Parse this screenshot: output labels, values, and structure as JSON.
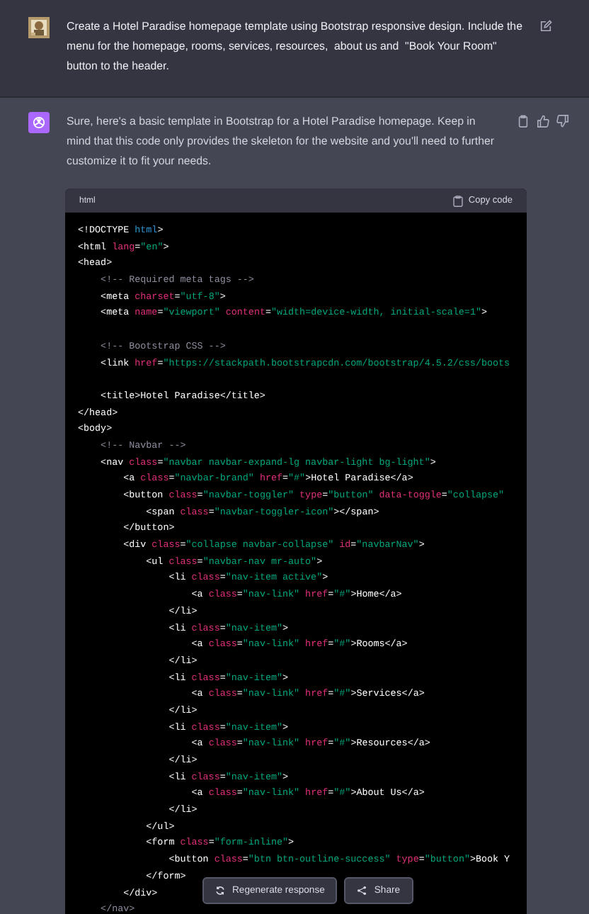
{
  "user_message": {
    "text": "Create a Hotel Paradise homepage template using Bootstrap responsive design. Include the menu for the homepage, rooms, services, resources,  about us and  \"Book Your Room\" button to the header."
  },
  "assistant_message": {
    "text": "Sure, here's a basic template in Bootstrap for a Hotel Paradise homepage. Keep in mind that this code only provides the skeleton for the website and you'll need to further customize it to fit your needs."
  },
  "code_block": {
    "language": "html",
    "copy_label": "Copy code",
    "lines": [
      {
        "tokens": [
          {
            "kind": "tag",
            "text": "<!DOCTYPE "
          },
          {
            "kind": "keyword",
            "text": "html"
          },
          {
            "kind": "tag",
            "text": ">"
          }
        ]
      },
      {
        "tokens": [
          {
            "kind": "tag",
            "text": "<html "
          },
          {
            "kind": "attr",
            "text": "lang"
          },
          {
            "kind": "tag",
            "text": "="
          },
          {
            "kind": "string",
            "text": "\"en\""
          },
          {
            "kind": "tag",
            "text": ">"
          }
        ]
      },
      {
        "tokens": [
          {
            "kind": "tag",
            "text": "<head>"
          }
        ]
      },
      {
        "tokens": [
          {
            "kind": "comment",
            "text": "    <!-- Required meta tags -->"
          }
        ]
      },
      {
        "tokens": [
          {
            "kind": "tag",
            "text": "    <meta "
          },
          {
            "kind": "attr",
            "text": "charset"
          },
          {
            "kind": "tag",
            "text": "="
          },
          {
            "kind": "string",
            "text": "\"utf-8\""
          },
          {
            "kind": "tag",
            "text": ">"
          }
        ]
      },
      {
        "tokens": [
          {
            "kind": "tag",
            "text": "    <meta "
          },
          {
            "kind": "attr",
            "text": "name"
          },
          {
            "kind": "tag",
            "text": "="
          },
          {
            "kind": "string",
            "text": "\"viewport\""
          },
          {
            "kind": "attr",
            "text": " content"
          },
          {
            "kind": "tag",
            "text": "="
          },
          {
            "kind": "string",
            "text": "\"width=device-width, initial-scale=1\""
          },
          {
            "kind": "tag",
            "text": ">"
          }
        ]
      },
      {
        "gap_before": true,
        "tokens": [
          {
            "kind": "comment",
            "text": "    <!-- Bootstrap CSS -->"
          }
        ]
      },
      {
        "tokens": [
          {
            "kind": "tag",
            "text": "    <link "
          },
          {
            "kind": "attr",
            "text": "href"
          },
          {
            "kind": "tag",
            "text": "="
          },
          {
            "kind": "string",
            "text": "\"https://stackpath.bootstrapcdn.com/bootstrap/4.5.2/css/boots"
          }
        ]
      },
      {
        "gap_before": true,
        "tokens": [
          {
            "kind": "tag",
            "text": "    <title>Hotel Paradise</title>"
          }
        ]
      },
      {
        "tokens": [
          {
            "kind": "tag",
            "text": "</head>"
          }
        ]
      },
      {
        "tokens": [
          {
            "kind": "tag",
            "text": "<body>"
          }
        ]
      },
      {
        "tokens": [
          {
            "kind": "comment",
            "text": "    <!-- Navbar -->"
          }
        ]
      },
      {
        "tokens": [
          {
            "kind": "tag",
            "text": "    <nav "
          },
          {
            "kind": "attr",
            "text": "class"
          },
          {
            "kind": "tag",
            "text": "="
          },
          {
            "kind": "string",
            "text": "\"navbar navbar-expand-lg navbar-light bg-light\""
          },
          {
            "kind": "tag",
            "text": ">"
          }
        ]
      },
      {
        "tokens": [
          {
            "kind": "tag",
            "text": "        <a "
          },
          {
            "kind": "attr",
            "text": "class"
          },
          {
            "kind": "tag",
            "text": "="
          },
          {
            "kind": "string",
            "text": "\"navbar-brand\""
          },
          {
            "kind": "attr",
            "text": " href"
          },
          {
            "kind": "tag",
            "text": "="
          },
          {
            "kind": "string",
            "text": "\"#\""
          },
          {
            "kind": "tag",
            "text": ">Hotel Paradise</a>"
          }
        ]
      },
      {
        "tokens": [
          {
            "kind": "tag",
            "text": "        <button "
          },
          {
            "kind": "attr",
            "text": "class"
          },
          {
            "kind": "tag",
            "text": "="
          },
          {
            "kind": "string",
            "text": "\"navbar-toggler\""
          },
          {
            "kind": "attr",
            "text": " type"
          },
          {
            "kind": "tag",
            "text": "="
          },
          {
            "kind": "string",
            "text": "\"button\""
          },
          {
            "kind": "attr",
            "text": " data-toggle"
          },
          {
            "kind": "tag",
            "text": "="
          },
          {
            "kind": "string",
            "text": "\"collapse\""
          }
        ]
      },
      {
        "tokens": [
          {
            "kind": "tag",
            "text": "            <span "
          },
          {
            "kind": "attr",
            "text": "class"
          },
          {
            "kind": "tag",
            "text": "="
          },
          {
            "kind": "string",
            "text": "\"navbar-toggler-icon\""
          },
          {
            "kind": "tag",
            "text": "></span>"
          }
        ]
      },
      {
        "tokens": [
          {
            "kind": "tag",
            "text": "        </button>"
          }
        ]
      },
      {
        "tokens": [
          {
            "kind": "tag",
            "text": "        <div "
          },
          {
            "kind": "attr",
            "text": "class"
          },
          {
            "kind": "tag",
            "text": "="
          },
          {
            "kind": "string",
            "text": "\"collapse navbar-collapse\""
          },
          {
            "kind": "attr",
            "text": " id"
          },
          {
            "kind": "tag",
            "text": "="
          },
          {
            "kind": "string",
            "text": "\"navbarNav\""
          },
          {
            "kind": "tag",
            "text": ">"
          }
        ]
      },
      {
        "tokens": [
          {
            "kind": "tag",
            "text": "            <ul "
          },
          {
            "kind": "attr",
            "text": "class"
          },
          {
            "kind": "tag",
            "text": "="
          },
          {
            "kind": "string",
            "text": "\"navbar-nav mr-auto\""
          },
          {
            "kind": "tag",
            "text": ">"
          }
        ]
      },
      {
        "tokens": [
          {
            "kind": "tag",
            "text": "                <li "
          },
          {
            "kind": "attr",
            "text": "class"
          },
          {
            "kind": "tag",
            "text": "="
          },
          {
            "kind": "string",
            "text": "\"nav-item active\""
          },
          {
            "kind": "tag",
            "text": ">"
          }
        ]
      },
      {
        "tokens": [
          {
            "kind": "tag",
            "text": "                    <a "
          },
          {
            "kind": "attr",
            "text": "class"
          },
          {
            "kind": "tag",
            "text": "="
          },
          {
            "kind": "string",
            "text": "\"nav-link\""
          },
          {
            "kind": "attr",
            "text": " href"
          },
          {
            "kind": "tag",
            "text": "="
          },
          {
            "kind": "string",
            "text": "\"#\""
          },
          {
            "kind": "tag",
            "text": ">Home</a>"
          }
        ]
      },
      {
        "tokens": [
          {
            "kind": "tag",
            "text": "                </li>"
          }
        ]
      },
      {
        "tokens": [
          {
            "kind": "tag",
            "text": "                <li "
          },
          {
            "kind": "attr",
            "text": "class"
          },
          {
            "kind": "tag",
            "text": "="
          },
          {
            "kind": "string",
            "text": "\"nav-item\""
          },
          {
            "kind": "tag",
            "text": ">"
          }
        ]
      },
      {
        "tokens": [
          {
            "kind": "tag",
            "text": "                    <a "
          },
          {
            "kind": "attr",
            "text": "class"
          },
          {
            "kind": "tag",
            "text": "="
          },
          {
            "kind": "string",
            "text": "\"nav-link\""
          },
          {
            "kind": "attr",
            "text": " href"
          },
          {
            "kind": "tag",
            "text": "="
          },
          {
            "kind": "string",
            "text": "\"#\""
          },
          {
            "kind": "tag",
            "text": ">Rooms</a>"
          }
        ]
      },
      {
        "tokens": [
          {
            "kind": "tag",
            "text": "                </li>"
          }
        ]
      },
      {
        "tokens": [
          {
            "kind": "tag",
            "text": "                <li "
          },
          {
            "kind": "attr",
            "text": "class"
          },
          {
            "kind": "tag",
            "text": "="
          },
          {
            "kind": "string",
            "text": "\"nav-item\""
          },
          {
            "kind": "tag",
            "text": ">"
          }
        ]
      },
      {
        "tokens": [
          {
            "kind": "tag",
            "text": "                    <a "
          },
          {
            "kind": "attr",
            "text": "class"
          },
          {
            "kind": "tag",
            "text": "="
          },
          {
            "kind": "string",
            "text": "\"nav-link\""
          },
          {
            "kind": "attr",
            "text": " href"
          },
          {
            "kind": "tag",
            "text": "="
          },
          {
            "kind": "string",
            "text": "\"#\""
          },
          {
            "kind": "tag",
            "text": ">Services</a>"
          }
        ]
      },
      {
        "tokens": [
          {
            "kind": "tag",
            "text": "                </li>"
          }
        ]
      },
      {
        "tokens": [
          {
            "kind": "tag",
            "text": "                <li "
          },
          {
            "kind": "attr",
            "text": "class"
          },
          {
            "kind": "tag",
            "text": "="
          },
          {
            "kind": "string",
            "text": "\"nav-item\""
          },
          {
            "kind": "tag",
            "text": ">"
          }
        ]
      },
      {
        "tokens": [
          {
            "kind": "tag",
            "text": "                    <a "
          },
          {
            "kind": "attr",
            "text": "class"
          },
          {
            "kind": "tag",
            "text": "="
          },
          {
            "kind": "string",
            "text": "\"nav-link\""
          },
          {
            "kind": "attr",
            "text": " href"
          },
          {
            "kind": "tag",
            "text": "="
          },
          {
            "kind": "string",
            "text": "\"#\""
          },
          {
            "kind": "tag",
            "text": ">Resources</a>"
          }
        ]
      },
      {
        "tokens": [
          {
            "kind": "tag",
            "text": "                </li>"
          }
        ]
      },
      {
        "tokens": [
          {
            "kind": "tag",
            "text": "                <li "
          },
          {
            "kind": "attr",
            "text": "class"
          },
          {
            "kind": "tag",
            "text": "="
          },
          {
            "kind": "string",
            "text": "\"nav-item\""
          },
          {
            "kind": "tag",
            "text": ">"
          }
        ]
      },
      {
        "tokens": [
          {
            "kind": "tag",
            "text": "                    <a "
          },
          {
            "kind": "attr",
            "text": "class"
          },
          {
            "kind": "tag",
            "text": "="
          },
          {
            "kind": "string",
            "text": "\"nav-link\""
          },
          {
            "kind": "attr",
            "text": " href"
          },
          {
            "kind": "tag",
            "text": "="
          },
          {
            "kind": "string",
            "text": "\"#\""
          },
          {
            "kind": "tag",
            "text": ">About Us</a>"
          }
        ]
      },
      {
        "tokens": [
          {
            "kind": "tag",
            "text": "                </li>"
          }
        ]
      },
      {
        "tokens": [
          {
            "kind": "tag",
            "text": "            </ul>"
          }
        ]
      },
      {
        "tokens": [
          {
            "kind": "tag",
            "text": "            <form "
          },
          {
            "kind": "attr",
            "text": "class"
          },
          {
            "kind": "tag",
            "text": "="
          },
          {
            "kind": "string",
            "text": "\"form-inline\""
          },
          {
            "kind": "tag",
            "text": ">"
          }
        ]
      },
      {
        "tokens": [
          {
            "kind": "tag",
            "text": "                <button "
          },
          {
            "kind": "attr",
            "text": "class"
          },
          {
            "kind": "tag",
            "text": "="
          },
          {
            "kind": "string",
            "text": "\"btn btn-outline-success\""
          },
          {
            "kind": "attr",
            "text": " type"
          },
          {
            "kind": "tag",
            "text": "="
          },
          {
            "kind": "string",
            "text": "\"button\""
          },
          {
            "kind": "tag",
            "text": ">Book Y"
          }
        ]
      },
      {
        "tokens": [
          {
            "kind": "tag",
            "text": "            </form>"
          }
        ]
      },
      {
        "tokens": [
          {
            "kind": "tag",
            "text": "        </div>"
          }
        ]
      },
      {
        "tokens": [
          {
            "kind": "comment",
            "text": "    </nav>"
          }
        ]
      }
    ]
  },
  "actions": [
    {
      "label": "Regenerate response",
      "kind": "regenerate"
    },
    {
      "label": "Share",
      "kind": "share"
    }
  ]
}
